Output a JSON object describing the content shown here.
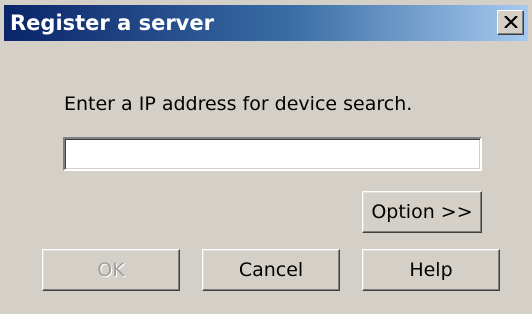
{
  "dialog": {
    "title": "Register a server",
    "close_icon": "close-icon",
    "prompt": "Enter a IP address for device search.",
    "ip_input": {
      "value": "",
      "placeholder": ""
    },
    "buttons": {
      "option": "Option >>",
      "ok": "OK",
      "cancel": "Cancel",
      "help": "Help"
    },
    "ok_enabled": false
  },
  "colors": {
    "window_face": "#d4d0c8",
    "titlebar_start": "#0a246a",
    "titlebar_end": "#a6caf0",
    "disabled_text": "#a0a0a0"
  }
}
